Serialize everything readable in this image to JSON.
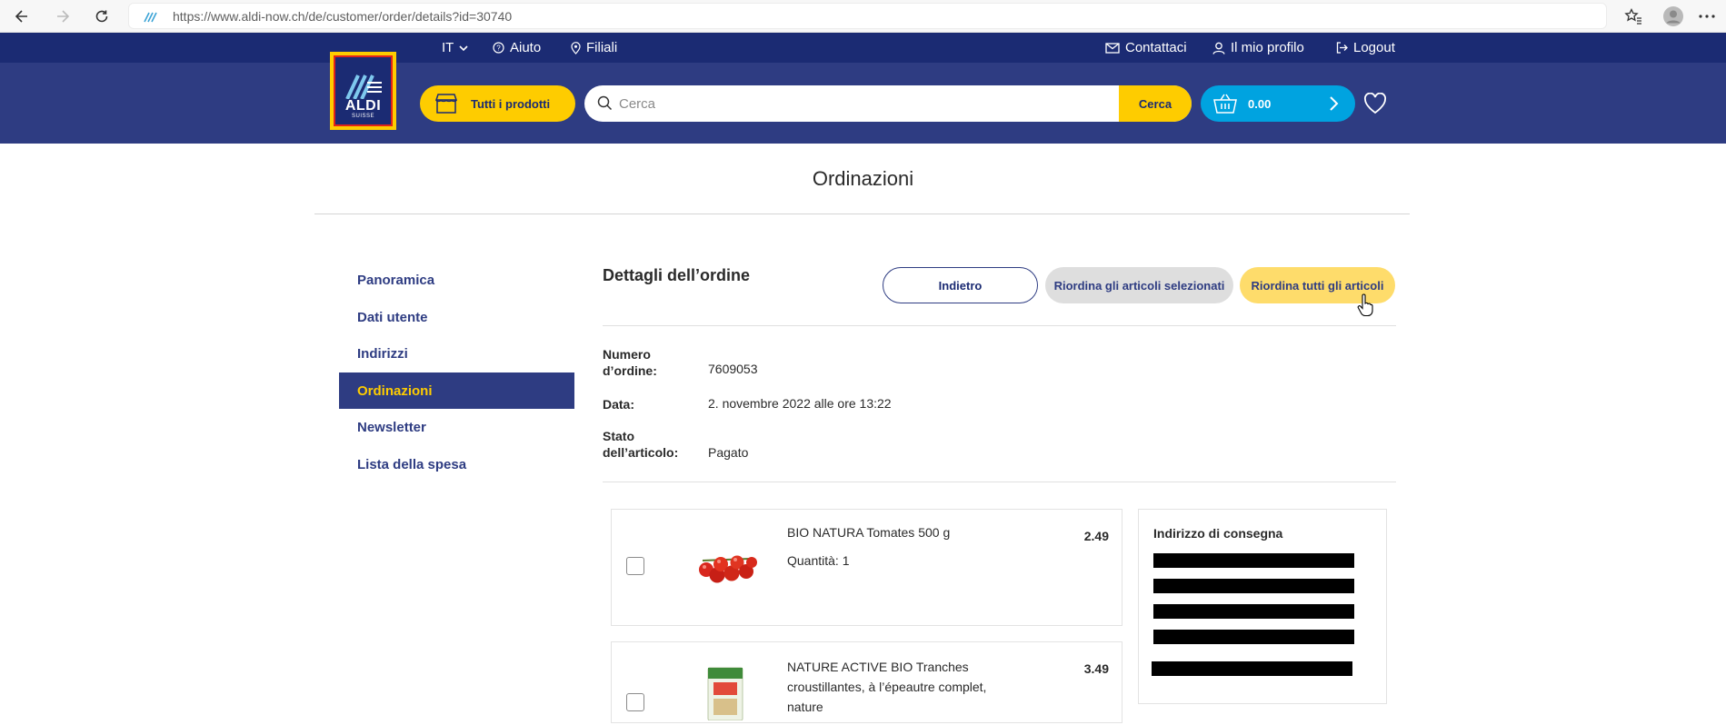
{
  "browser": {
    "url": "https://www.aldi-now.ch/de/customer/order/details?id=30740",
    "icons": [
      "back-arrow-icon",
      "forward-arrow-icon",
      "reload-icon",
      "favorites-icon",
      "profile-avatar-icon",
      "more-icon"
    ]
  },
  "top_strip": {
    "language": "IT",
    "help": "Aiuto",
    "stores": "Filiali",
    "contact": "Contattaci",
    "profile": "Il mio profilo",
    "logout": "Logout"
  },
  "logo": {
    "word": "ALDI",
    "sub": "SUISSE"
  },
  "header": {
    "all_products": "Tutti i prodotti",
    "search_placeholder": "Cerca",
    "search_button": "Cerca",
    "cart_total": "0.00"
  },
  "page": {
    "title": "Ordinazioni"
  },
  "sidebar": {
    "items": [
      {
        "label": "Panoramica",
        "active": false
      },
      {
        "label": "Dati utente",
        "active": false
      },
      {
        "label": "Indirizzi",
        "active": false
      },
      {
        "label": "Ordinazioni",
        "active": true
      },
      {
        "label": "Newsletter",
        "active": false
      },
      {
        "label": "Lista della spesa",
        "active": false
      }
    ]
  },
  "order": {
    "heading": "Dettagli dell’ordine",
    "back_button": "Indietro",
    "reorder_selected_button": "Riordina gli articoli selezionati",
    "reorder_all_button": "Riordina tutti gli articoli",
    "number_label_1": "Numero",
    "number_label_2": "d’ordine:",
    "number_value": "7609053",
    "date_label": "Data:",
    "date_value": "2. novembre 2022 alle ore 13:22",
    "status_label_1": "Stato",
    "status_label_2": "dell’articolo:",
    "status_value": "Pagato",
    "items": [
      {
        "name": "BIO NATURA Tomates 500 g",
        "quantity": "Quantità: 1",
        "price": "2.49",
        "image": "tomatoes-image"
      },
      {
        "name_lines": [
          "NATURE ACTIVE BIO Tranches",
          "croustillantes, à l’épeautre complet,",
          "nature"
        ],
        "price": "3.49",
        "image": "crispbread-image"
      }
    ],
    "delivery_title": "Indirizzo di consegna"
  },
  "colors": {
    "navy": "#1b2b73",
    "header_blue": "#2e3c82",
    "yellow": "#fecc00",
    "cart_blue": "#00a3e0"
  }
}
